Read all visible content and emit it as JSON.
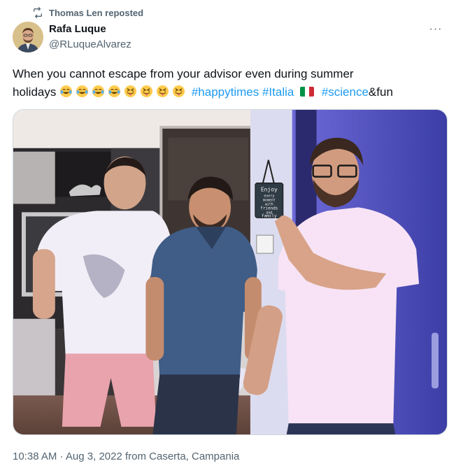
{
  "repost": {
    "text": "Thomas Len reposted",
    "icon": "repost-icon"
  },
  "author": {
    "name": "Rafa Luque",
    "handle": "@RLuqueAlvarez"
  },
  "more_label": "···",
  "tweet": {
    "line1": "When you cannot escape from your advisor even during summer",
    "line2_prefix": "holidays",
    "emojis": [
      "tears-of-joy",
      "tears-of-joy",
      "tears-of-joy",
      "tears-of-joy",
      "squinting-tongue",
      "squinting-tongue",
      "squinting-tongue",
      "squinting-tongue"
    ],
    "hashtags": [
      "#happytimes",
      "#Italia",
      "#science"
    ],
    "suffix": "&fun"
  },
  "photo": {
    "sign_lines": [
      "Enjoy",
      "every",
      "moment",
      "with",
      "friends",
      "and",
      "family"
    ]
  },
  "meta": {
    "time": "10:38 AM",
    "separator": "·",
    "date": "Aug 3, 2022",
    "location": "from Caserta, Campania"
  },
  "colors": {
    "link": "#1d9bf0",
    "secondary": "#536471",
    "text": "#0f1419"
  }
}
